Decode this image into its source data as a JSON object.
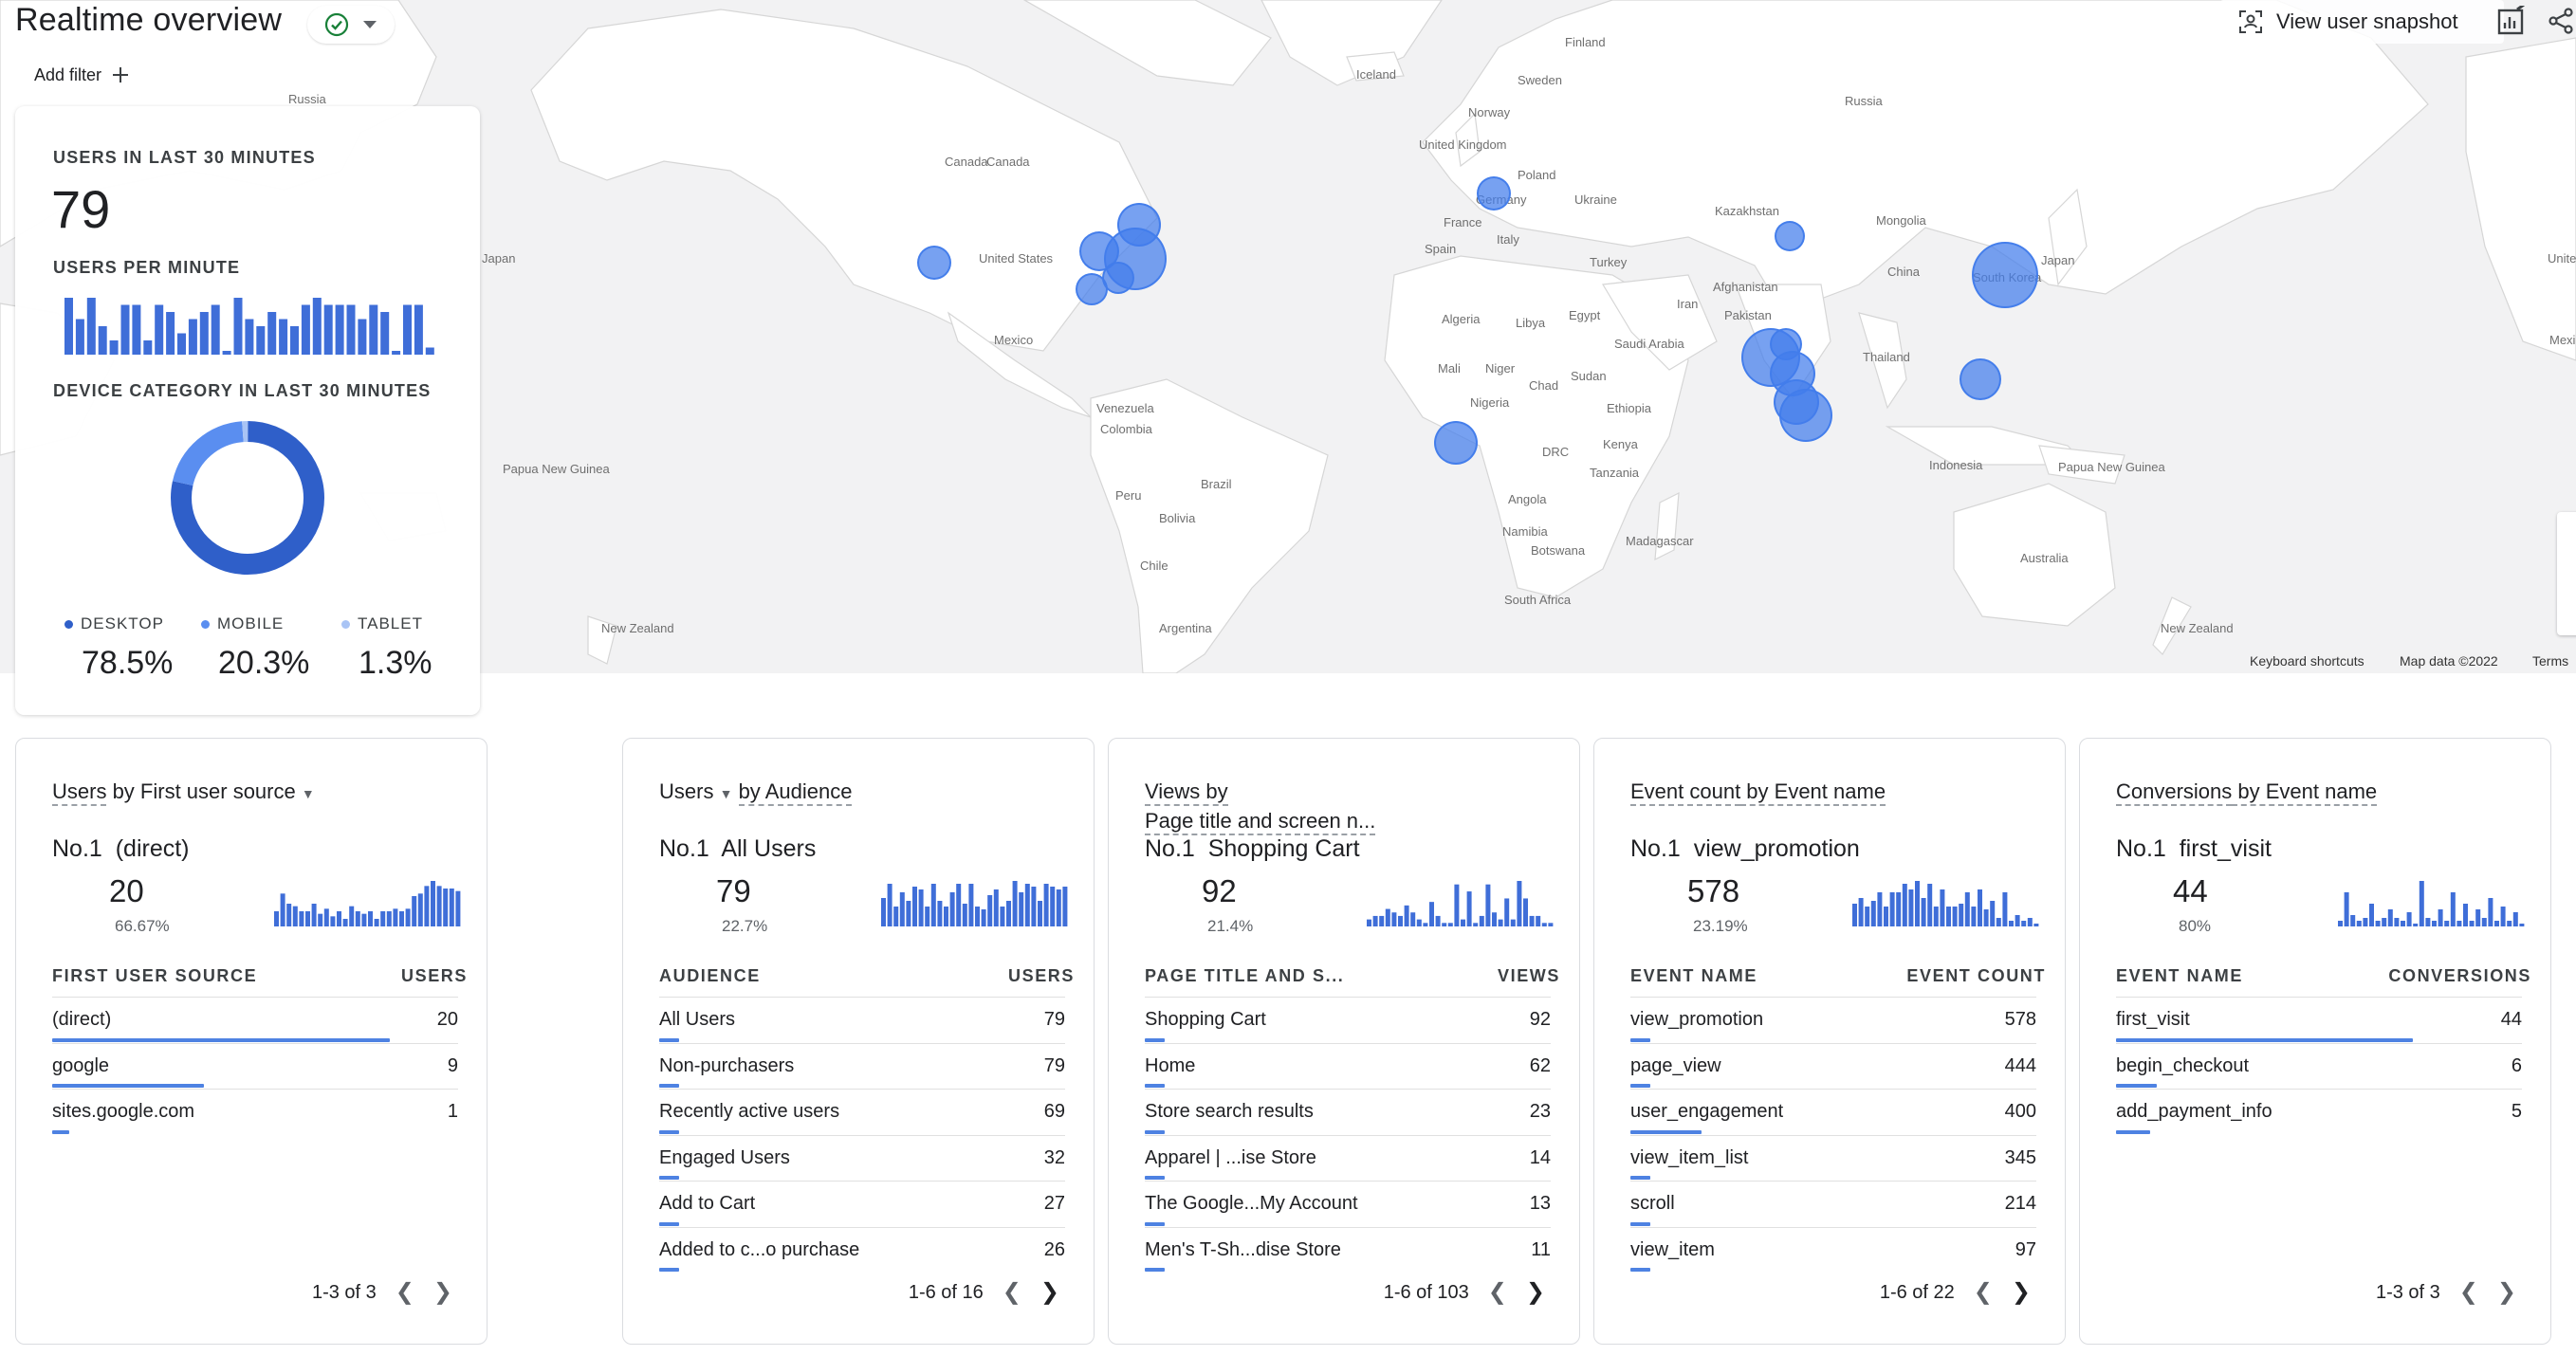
{
  "header": {
    "title": "Realtime overview",
    "add_filter_label": "Add filter",
    "snapshot_label": "View user snapshot"
  },
  "colors": {
    "accent": "#3f6ed8",
    "desktop": "#2f5fc9",
    "mobile": "#5a8ef0",
    "tablet": "#a9c4f5",
    "status_ok": "#188038"
  },
  "map": {
    "labels": [
      "Finland",
      "Sweden",
      "Norway",
      "Russia",
      "Iceland",
      "United Kingdom",
      "Poland",
      "Germany",
      "Ukraine",
      "France",
      "Italy",
      "Spain",
      "Kazakhstan",
      "Mongolia",
      "Turkey",
      "Afghanistan",
      "Iran",
      "Pakistan",
      "China",
      "Japan",
      "South Korea",
      "Thailand",
      "Algeria",
      "Libya",
      "Egypt",
      "Saudi Arabia",
      "Mali",
      "Niger",
      "Chad",
      "Sudan",
      "Nigeria",
      "Ethiopia",
      "DRC",
      "Kenya",
      "Tanzania",
      "Angola",
      "Namibia",
      "Botswana",
      "Madagascar",
      "South Africa",
      "Canada",
      "United States",
      "Mexico",
      "Venezuela",
      "Colombia",
      "Peru",
      "Brazil",
      "Bolivia",
      "Chile",
      "Argentina",
      "Indonesia",
      "Papua New Guinea",
      "Australia",
      "New Zealand",
      "Japan",
      "Canada",
      "Mexico",
      "Papua New Guinea",
      "New Zealand",
      "Russia",
      "United"
    ],
    "footer": {
      "shortcuts": "Keyboard shortcuts",
      "map_data": "Map data ©2022",
      "terms": "Terms"
    }
  },
  "summary": {
    "users_label": "USERS IN LAST 30 MINUTES",
    "users_value": "79",
    "per_minute_label": "USERS PER MINUTE",
    "per_minute_values": [
      8,
      5,
      8,
      4,
      2,
      7,
      7,
      2,
      7,
      6,
      3,
      5,
      6,
      7,
      0,
      8,
      5,
      4,
      6,
      5,
      4,
      7,
      8,
      7,
      7,
      7,
      5,
      7,
      6,
      0,
      7,
      7,
      1
    ],
    "device_label": "DEVICE CATEGORY IN LAST 30 MINUTES",
    "devices": [
      {
        "name": "DESKTOP",
        "value": "78.5%",
        "share": 0.785
      },
      {
        "name": "MOBILE",
        "value": "20.3%",
        "share": 0.203
      },
      {
        "name": "TABLET",
        "value": "1.3%",
        "share": 0.013
      }
    ]
  },
  "cards": [
    {
      "title_a": "Users",
      "title_b": " by First user source",
      "has_dropdown": true,
      "no_label": "No.1",
      "top_name": "(direct)",
      "big": "20",
      "pct": "66.67%",
      "col1": "FIRST USER SOURCE",
      "col2": "USERS",
      "spark": [
        6,
        13,
        9,
        8,
        6,
        6,
        9,
        5,
        7,
        4,
        6,
        3,
        8,
        6,
        5,
        6,
        3,
        6,
        6,
        7,
        6,
        7,
        12,
        13,
        16,
        18,
        16,
        15,
        15,
        14
      ],
      "rows": [
        {
          "label": "(direct)",
          "value": "20",
          "share": 1.0
        },
        {
          "label": "google",
          "value": "9",
          "share": 0.45
        },
        {
          "label": "sites.google.com",
          "value": "1",
          "share": 0.05
        }
      ],
      "pager": "1-3 of 3",
      "next_active": false
    },
    {
      "title_a": "Users",
      "title_b": "by Audience",
      "has_dropdown": true,
      "no_label": "No.1",
      "top_name": "All Users",
      "big": "79",
      "pct": "22.7%",
      "col1": "AUDIENCE",
      "col2": "USERS",
      "spark": [
        10,
        15,
        7,
        12,
        9,
        14,
        13,
        7,
        15,
        9,
        7,
        12,
        15,
        8,
        15,
        7,
        6,
        11,
        13,
        7,
        9,
        16,
        12,
        15,
        14,
        9,
        15,
        14,
        13,
        14
      ],
      "rows": [
        {
          "label": "All Users",
          "value": "79",
          "share": 0.06
        },
        {
          "label": "Non-purchasers",
          "value": "79",
          "share": 0.06
        },
        {
          "label": "Recently active users",
          "value": "69",
          "share": 0.06
        },
        {
          "label": "Engaged Users",
          "value": "32",
          "share": 0.06
        },
        {
          "label": "Add to Cart",
          "value": "27",
          "share": 0.06
        },
        {
          "label": "Added to c...o purchase",
          "value": "26",
          "share": 0.06
        }
      ],
      "pager": "1-6 of 16",
      "next_active": true
    },
    {
      "title_a": "Views by",
      "title_b": "Page title and screen n...",
      "has_dropdown": false,
      "no_label": "No.1",
      "top_name": "Shopping Cart",
      "big": "92",
      "pct": "21.4%",
      "col1": "PAGE TITLE AND S...",
      "col2": "VIEWS",
      "spark": [
        2,
        3,
        3,
        5,
        4,
        3,
        6,
        4,
        2,
        1,
        7,
        3,
        1,
        1,
        12,
        2,
        10,
        1,
        3,
        12,
        4,
        2,
        8,
        2,
        13,
        8,
        3,
        3,
        1,
        1
      ],
      "rows": [
        {
          "label": "Shopping Cart",
          "value": "92",
          "share": 0.06
        },
        {
          "label": "Home",
          "value": "62",
          "share": 0.06
        },
        {
          "label": "Store search results",
          "value": "23",
          "share": 0.06
        },
        {
          "label": "Apparel | ...ise Store",
          "value": "14",
          "share": 0.06
        },
        {
          "label": "The Google...My Account",
          "value": "13",
          "share": 0.06
        },
        {
          "label": "Men's T-Sh...dise Store",
          "value": "11",
          "share": 0.06
        }
      ],
      "pager": "1-6 of 103",
      "next_active": true
    },
    {
      "title_a": "Event count",
      "title_b": " by Event name",
      "has_dropdown": false,
      "no_label": "No.1",
      "top_name": "view_promotion",
      "big": "578",
      "pct": "23.19%",
      "col1": "EVENT NAME",
      "col2": "EVENT COUNT",
      "spark": [
        8,
        10,
        7,
        9,
        12,
        7,
        12,
        12,
        15,
        13,
        16,
        10,
        15,
        7,
        13,
        7,
        7,
        8,
        12,
        7,
        13,
        6,
        9,
        3,
        12,
        2,
        4,
        2,
        3,
        1
      ],
      "rows": [
        {
          "label": "view_promotion",
          "value": "578",
          "share": 0.06
        },
        {
          "label": "page_view",
          "value": "444",
          "share": 0.06
        },
        {
          "label": "user_engagement",
          "value": "400",
          "share": 0.21
        },
        {
          "label": "view_item_list",
          "value": "345",
          "share": 0.06
        },
        {
          "label": "scroll",
          "value": "214",
          "share": 0.06
        },
        {
          "label": "view_item",
          "value": "97",
          "share": 0.06
        }
      ],
      "pager": "1-6 of 22",
      "next_active": true
    },
    {
      "title_a": "Conversions",
      "title_b": " by Event name",
      "has_dropdown": false,
      "no_label": "No.1",
      "top_name": "first_visit",
      "big": "44",
      "pct": "80%",
      "col1": "EVENT NAME",
      "col2": "CONVERSIONS",
      "spark": [
        2,
        12,
        4,
        2,
        3,
        8,
        2,
        3,
        6,
        3,
        2,
        5,
        1,
        16,
        3,
        2,
        6,
        2,
        12,
        2,
        8,
        2,
        6,
        3,
        10,
        2,
        7,
        2,
        5,
        1
      ],
      "rows": [
        {
          "label": "first_visit",
          "value": "44",
          "share": 0.88
        },
        {
          "label": "begin_checkout",
          "value": "6",
          "share": 0.12
        },
        {
          "label": "add_payment_info",
          "value": "5",
          "share": 0.1
        }
      ],
      "pager": "1-3 of 3",
      "next_active": false
    }
  ]
}
